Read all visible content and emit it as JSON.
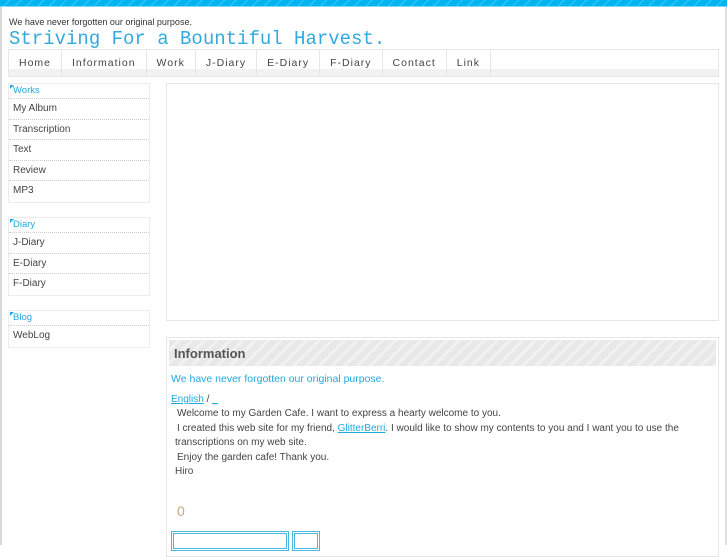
{
  "header": {
    "tagline": "We have never forgotten our original purpose.",
    "title": "Striving For a Bountiful Harvest."
  },
  "nav": [
    "Home",
    "Information",
    "Work",
    "J-Diary",
    "E-Diary",
    "F-Diary",
    "Contact",
    "Link"
  ],
  "sidebar": {
    "works": {
      "title": "Works",
      "items": [
        "My Album",
        "Transcription",
        "Text",
        "Review",
        "MP3"
      ]
    },
    "diary": {
      "title": "Diary",
      "items": [
        "J-Diary",
        "E-Diary",
        "F-Diary"
      ]
    },
    "blog": {
      "title": "Blog",
      "items": [
        "WebLog"
      ]
    }
  },
  "info": {
    "heading": "Information",
    "lead": "We have never forgotten our original purpose.",
    "lang_link": "English",
    "lang_sep": " / ",
    "lang_other": "_",
    "line1": "Welcome to my Garden Cafe. I want to express a hearty welcome to you.",
    "line2a": "I created this web site for my friend, ",
    "friend_link": "GlitterBerri",
    "line2b": ".  I would like to show my contents to you and I want you to use the transcriptions on my web site.",
    "line3": "Enjoy the garden cafe! Thank you.",
    "signature": "Hiro",
    "counter": "0"
  }
}
